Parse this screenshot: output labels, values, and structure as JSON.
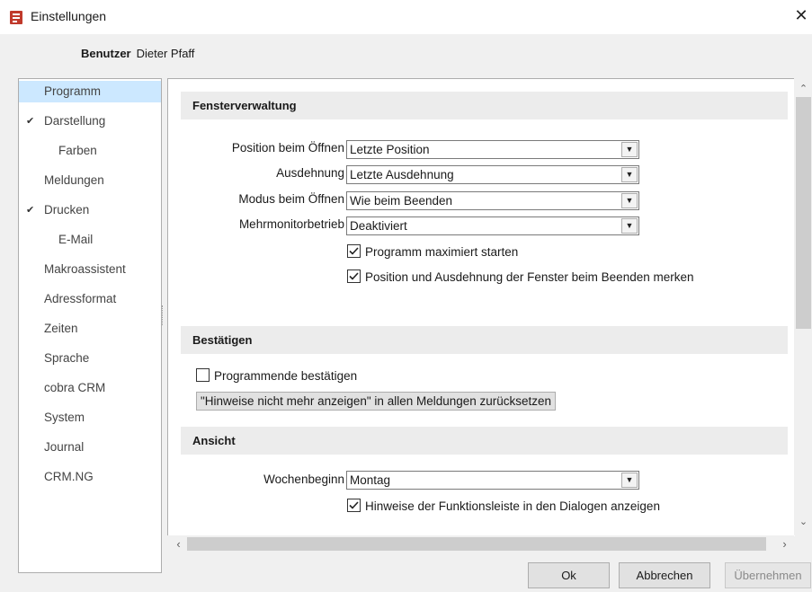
{
  "window": {
    "title": "Einstellungen",
    "close_icon": "close-icon"
  },
  "user": {
    "label": "Benutzer",
    "name": "Dieter Pfaff"
  },
  "nav": {
    "items": [
      {
        "label": "Programm",
        "indent": 0,
        "selected": true
      },
      {
        "label": "Darstellung",
        "indent": 0,
        "expanded": true
      },
      {
        "label": "Farben",
        "indent": 1
      },
      {
        "label": "Meldungen",
        "indent": 0
      },
      {
        "label": "Drucken",
        "indent": 0,
        "expanded": true
      },
      {
        "label": "E-Mail",
        "indent": 1
      },
      {
        "label": "Makroassistent",
        "indent": 0
      },
      {
        "label": "Adressformat",
        "indent": 0
      },
      {
        "label": "Zeiten",
        "indent": 0
      },
      {
        "label": "Sprache",
        "indent": 0
      },
      {
        "label": "cobra CRM",
        "indent": 0
      },
      {
        "label": "System",
        "indent": 0
      },
      {
        "label": "Journal",
        "indent": 0
      },
      {
        "label": "CRM.NG",
        "indent": 0
      }
    ]
  },
  "fensterverwaltung": {
    "heading": "Fensterverwaltung",
    "position": {
      "label": "Position beim Öffnen",
      "value": "Letzte Position"
    },
    "ausdehnung": {
      "label": "Ausdehnung",
      "value": "Letzte Ausdehnung"
    },
    "modus": {
      "label": "Modus beim Öffnen",
      "value": "Wie beim Beenden"
    },
    "mehrmonitor": {
      "label": "Mehrmonitorbetrieb",
      "value": "Deaktiviert"
    },
    "maximiert": {
      "label": "Programm maximiert starten",
      "checked": true
    },
    "merken": {
      "label": "Position und Ausdehnung der Fenster beim Beenden merken",
      "checked": true
    }
  },
  "bestaetigen": {
    "heading": "Bestätigen",
    "programmende": {
      "label": "Programmende bestätigen",
      "checked": false
    },
    "reset_button": "\"Hinweise nicht mehr anzeigen\" in allen Meldungen zurücksetzen"
  },
  "ansicht": {
    "heading": "Ansicht",
    "wochenbeginn": {
      "label": "Wochenbeginn",
      "value": "Montag"
    },
    "hinweise": {
      "label": "Hinweise der Funktionsleiste in den Dialogen anzeigen",
      "checked": true
    }
  },
  "footer": {
    "ok": "Ok",
    "cancel": "Abbrechen",
    "apply": "Übernehmen"
  },
  "colors": {
    "selection": "#cce8ff",
    "section_bg": "#ececec",
    "window_bg": "#f0f0f0",
    "app_icon": "#c0392b"
  }
}
